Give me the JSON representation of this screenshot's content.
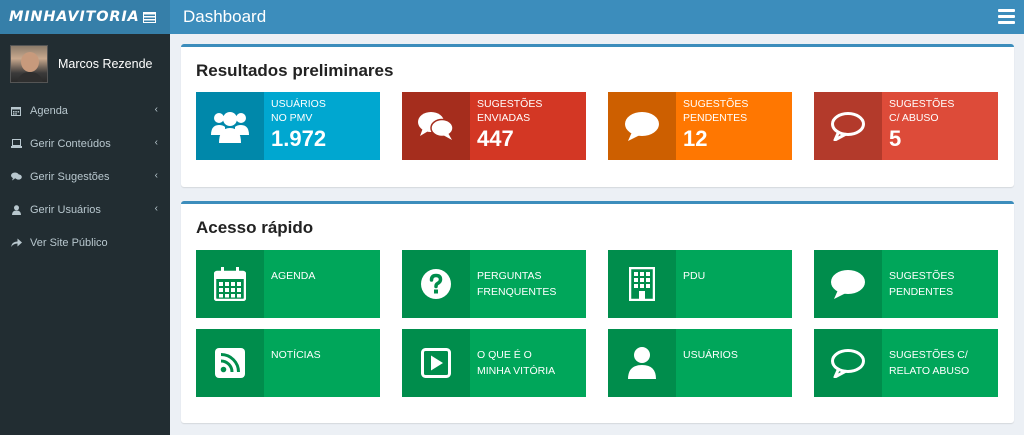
{
  "app": {
    "logo_text": "MINHAVITORIA",
    "header_title": "Dashboard"
  },
  "user": {
    "name": "Marcos Rezende"
  },
  "sidebar": {
    "items": [
      {
        "label": "Agenda",
        "icon": "calendar-icon",
        "has_submenu": true
      },
      {
        "label": "Gerir Conteúdos",
        "icon": "laptop-icon",
        "has_submenu": true
      },
      {
        "label": "Gerir Sugestões",
        "icon": "comments-icon",
        "has_submenu": true
      },
      {
        "label": "Gerir Usuários",
        "icon": "user-icon",
        "has_submenu": true
      },
      {
        "label": "Ver Site Público",
        "icon": "share-icon",
        "has_submenu": false
      }
    ]
  },
  "results": {
    "title": "Resultados preliminares",
    "tiles": [
      {
        "label_line1": "USUÁRIOS",
        "label_line2": "NO PMV",
        "value": "1.972",
        "icon": "users-icon",
        "color": "#00a7d0"
      },
      {
        "label_line1": "SUGESTÕES",
        "label_line2": "ENVIADAS",
        "value": "447",
        "icon": "comments-icon",
        "color": "#d33724"
      },
      {
        "label_line1": "SUGESTÕES",
        "label_line2": "PENDENTES",
        "value": "12",
        "icon": "comment-icon",
        "color": "#ff7701"
      },
      {
        "label_line1": "SUGESTÕES",
        "label_line2": "C/ ABUSO",
        "value": "5",
        "icon": "comment-outline-icon",
        "color": "#dd4b39"
      }
    ]
  },
  "quick_access": {
    "title": "Acesso rápido",
    "tiles": [
      {
        "label_line1": "AGENDA",
        "label_line2": "",
        "icon": "calendar-icon"
      },
      {
        "label_line1": "PERGUNTAS",
        "label_line2": "FRENQUENTES",
        "icon": "question-circle-icon"
      },
      {
        "label_line1": "PDU",
        "label_line2": "",
        "icon": "building-icon"
      },
      {
        "label_line1": "SUGESTÕES",
        "label_line2": "PENDENTES",
        "icon": "comment-icon"
      },
      {
        "label_line1": "NOTÍCIAS",
        "label_line2": "",
        "icon": "rss-icon"
      },
      {
        "label_line1": "O QUE É O",
        "label_line2": "MINHA VITÓRIA",
        "icon": "play-icon"
      },
      {
        "label_line1": "USUÁRIOS",
        "label_line2": "",
        "icon": "user-icon"
      },
      {
        "label_line1": "SUGESTÕES C/",
        "label_line2": "RELATO ABUSO",
        "icon": "comment-outline-icon"
      }
    ]
  },
  "colors": {
    "header": "#3c8dbc",
    "sidebar": "#222d32",
    "quick_tile": "#00a65a"
  }
}
